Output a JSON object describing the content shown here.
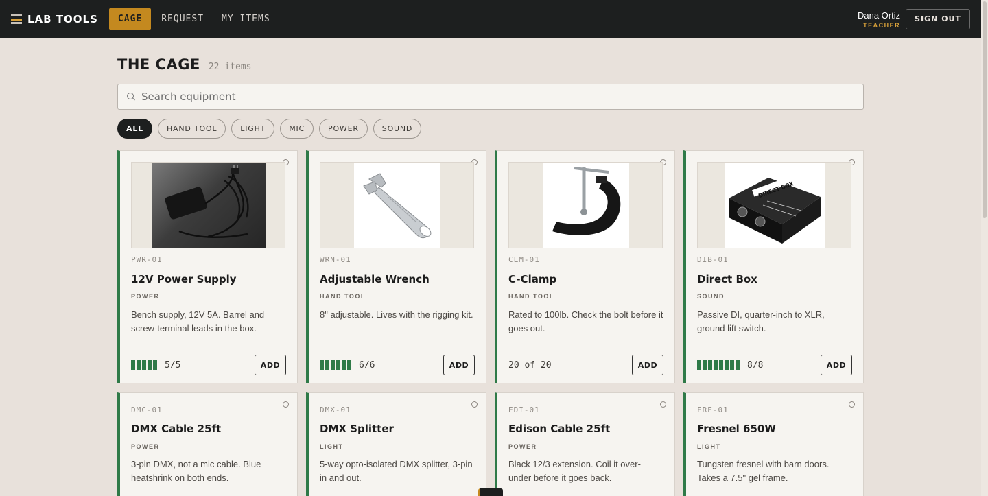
{
  "app": {
    "title": "LAB TOOLS"
  },
  "nav": [
    {
      "label": "CAGE",
      "active": true
    },
    {
      "label": "REQUEST",
      "active": false
    },
    {
      "label": "MY ITEMS",
      "active": false
    }
  ],
  "user": {
    "name": "Dana Ortiz",
    "role": "TEACHER",
    "signout_label": "SIGN OUT"
  },
  "page": {
    "title": "THE CAGE",
    "count": "22 items"
  },
  "search": {
    "placeholder": "Search equipment",
    "value": ""
  },
  "filters": [
    {
      "label": "ALL",
      "active": true
    },
    {
      "label": "HAND TOOL",
      "active": false
    },
    {
      "label": "LIGHT",
      "active": false
    },
    {
      "label": "MIC",
      "active": false
    },
    {
      "label": "POWER",
      "active": false
    },
    {
      "label": "SOUND",
      "active": false
    }
  ],
  "items": [
    {
      "sku": "PWR-01",
      "name": "12V Power Supply",
      "category": "POWER",
      "description": "Bench supply, 12V 5A. Barrel and screw-terminal leads in the box.",
      "available": 5,
      "total": 5,
      "stock_label": "5/5",
      "add_label": "ADD"
    },
    {
      "sku": "WRN-01",
      "name": "Adjustable Wrench",
      "category": "HAND TOOL",
      "description": "8\" adjustable. Lives with the rigging kit.",
      "available": 6,
      "total": 6,
      "stock_label": "6/6",
      "add_label": "ADD"
    },
    {
      "sku": "CLM-01",
      "name": "C-Clamp",
      "category": "HAND TOOL",
      "description": "Rated to 100lb. Check the bolt before it goes out.",
      "available": 20,
      "total": 20,
      "stock_label": "20 of 20",
      "add_label": "ADD"
    },
    {
      "sku": "DIB-01",
      "name": "Direct Box",
      "category": "SOUND",
      "description": "Passive DI, quarter-inch to XLR, ground lift switch.",
      "available": 8,
      "total": 8,
      "stock_label": "8/8",
      "add_label": "ADD"
    },
    {
      "sku": "DMC-01",
      "name": "DMX Cable 25ft",
      "category": "POWER",
      "description": "3-pin DMX, not a mic cable. Blue heatshrink on both ends."
    },
    {
      "sku": "DMX-01",
      "name": "DMX Splitter",
      "category": "LIGHT",
      "description": "5-way opto-isolated DMX splitter, 3-pin in and out."
    },
    {
      "sku": "EDI-01",
      "name": "Edison Cable 25ft",
      "category": "POWER",
      "description": "Black 12/3 extension. Coil it over-under before it goes back."
    },
    {
      "sku": "FRE-01",
      "name": "Fresnel 650W",
      "category": "LIGHT",
      "description": "Tungsten fresnel with barn doors. Takes a 7.5\" gel frame."
    }
  ],
  "direct_box_label": "DIRECT BOX",
  "colors": {
    "accent": "#c4891f",
    "stock": "#2f7a48",
    "topbar": "#1d1f1f",
    "background": "#e8e1db"
  }
}
